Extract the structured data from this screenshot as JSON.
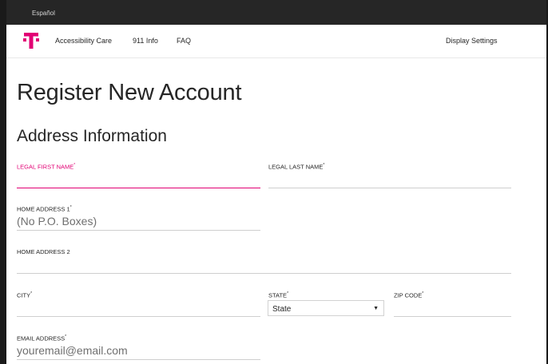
{
  "header": {
    "language_link": "Español",
    "logo_letter": "T",
    "nav": [
      "Accessibility Care",
      "911 Info",
      "FAQ"
    ],
    "display_settings": "Display Settings"
  },
  "page": {
    "title": "Register New Account",
    "section": "Address Information"
  },
  "form": {
    "first_name_label": "LEGAL FIRST NAME",
    "first_name_value": "",
    "last_name_label": "LEGAL LAST NAME",
    "last_name_value": "",
    "address1_label": "HOME ADDRESS 1",
    "address1_placeholder": "(No P.O. Boxes)",
    "address2_label": "HOME ADDRESS 2",
    "address2_value": "",
    "city_label": "CITY",
    "city_value": "",
    "state_label": "STATE",
    "state_selected": "State",
    "zip_label": "ZIP CODE",
    "zip_value": "",
    "email_label": "EMAIL ADDRESS",
    "email_placeholder": "youremail@email.com",
    "required_mark": "*"
  },
  "colors": {
    "brand": "#e20074",
    "topbar": "#262626",
    "text": "#262626",
    "border": "#cfcfcf"
  }
}
